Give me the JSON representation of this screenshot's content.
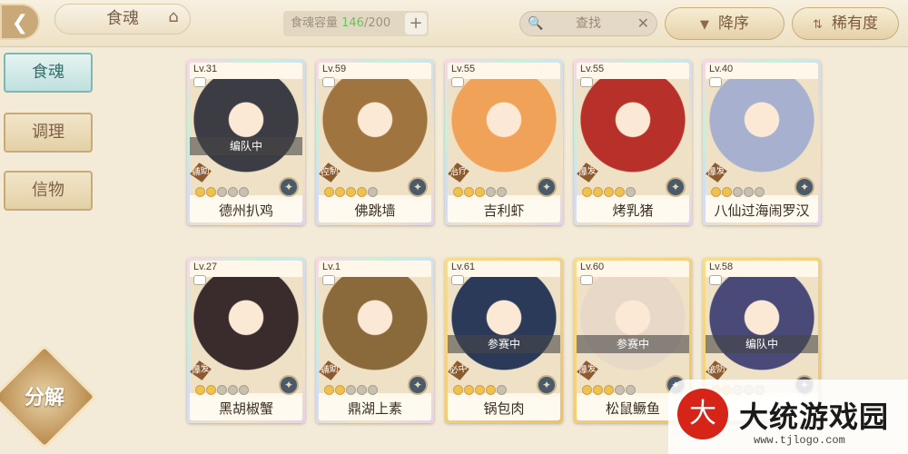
{
  "header": {
    "back_icon": "back-arrow-icon",
    "tab_title": "食魂",
    "home_icon": "home-icon",
    "capacity_label": "食魂容量 ",
    "capacity_count": "146",
    "capacity_total": "/200",
    "plus": "+",
    "search_placeholder": "查找",
    "sort_desc_label": "降序",
    "sort_rarity_label": "稀有度"
  },
  "sidebar": {
    "items": [
      {
        "label": "食魂",
        "active": true
      },
      {
        "label": "调理",
        "active": false
      },
      {
        "label": "信物",
        "active": false
      }
    ],
    "fenjie_label": "分解"
  },
  "cards": [
    {
      "lv": "Lv.31",
      "name": "德州扒鸡",
      "status": "编队中",
      "role": "辅助",
      "stars_on": 2,
      "rarity": "ur",
      "accent": "#3c3c44"
    },
    {
      "lv": "Lv.59",
      "name": "佛跳墙",
      "status": "",
      "role": "控制",
      "stars_on": 4,
      "rarity": "ur",
      "accent": "#a0743f"
    },
    {
      "lv": "Lv.55",
      "name": "吉利虾",
      "status": "",
      "role": "治疗",
      "stars_on": 3,
      "rarity": "ur",
      "accent": "#f0a258"
    },
    {
      "lv": "Lv.55",
      "name": "烤乳猪",
      "status": "",
      "role": "爆发",
      "stars_on": 4,
      "rarity": "ur",
      "accent": "#b8302a"
    },
    {
      "lv": "Lv.40",
      "name": "八仙过海闹罗汉",
      "status": "",
      "role": "爆发",
      "stars_on": 2,
      "rarity": "ur",
      "accent": "#a8b0d0"
    },
    {
      "lv": "Lv.27",
      "name": "黑胡椒蟹",
      "status": "",
      "role": "爆发",
      "stars_on": 2,
      "rarity": "ur",
      "accent": "#3a2c2c"
    },
    {
      "lv": "Lv.1",
      "name": "鼎湖上素",
      "status": "",
      "role": "辅助",
      "stars_on": 2,
      "rarity": "ur",
      "accent": "#8a6a3a"
    },
    {
      "lv": "Lv.61",
      "name": "锅包肉",
      "status": "参赛中",
      "role": "必中",
      "stars_on": 4,
      "rarity": "sr",
      "accent": "#2c3a5a"
    },
    {
      "lv": "Lv.60",
      "name": "松鼠鳜鱼",
      "status": "参赛中",
      "role": "爆发",
      "stars_on": 3,
      "rarity": "sr",
      "accent": "#e8d8c8"
    },
    {
      "lv": "Lv.58",
      "name": "",
      "status": "编队中",
      "role": "破防",
      "stars_on": 2,
      "rarity": "sr",
      "accent": "#4a4a78"
    }
  ],
  "watermark": {
    "logo": "大",
    "text": "大统游戏园",
    "url": "www.tjlogo.com"
  }
}
